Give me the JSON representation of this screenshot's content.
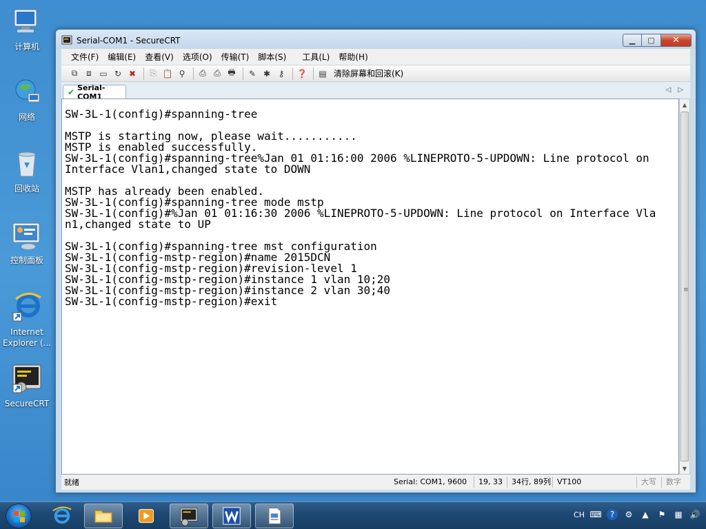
{
  "desktop": {
    "icons": [
      {
        "label": "计算机"
      },
      {
        "label": "网络"
      },
      {
        "label": "回收站"
      },
      {
        "label": "控制面板"
      },
      {
        "label": "Internet\nExplorer (..."
      },
      {
        "label": "SecureCRT"
      }
    ]
  },
  "window": {
    "title": "Serial-COM1 - SecureCRT",
    "min_label": "▁",
    "max_label": "▢",
    "close_label": "✕"
  },
  "menu": {
    "items": [
      "文件(F)",
      "编辑(E)",
      "查看(V)",
      "选项(O)",
      "传输(T)",
      "脚本(S)",
      "工具(L)",
      "帮助(H)"
    ]
  },
  "toolbar": {
    "clear_label": "清除屏幕和回滚(K)"
  },
  "tab": {
    "label": "Serial-COM1"
  },
  "terminal": {
    "lines": [
      "SW-3L-1(config)#spanning-tree",
      "",
      "MSTP is starting now, please wait...........",
      "MSTP is enabled successfully.",
      "SW-3L-1(config)#spanning-tree%Jan 01 01:16:00 2006 %LINEPROTO-5-UPDOWN: Line protocol on",
      "Interface Vlan1,changed state to DOWN",
      "",
      "MSTP has already been enabled.",
      "SW-3L-1(config)#spanning-tree mode mstp",
      "SW-3L-1(config)#%Jan 01 01:16:30 2006 %LINEPROTO-5-UPDOWN: Line protocol on Interface Vla",
      "n1,changed state to UP",
      "",
      "SW-3L-1(config)#spanning-tree mst configuration",
      "SW-3L-1(config-mstp-region)#name 2015DCN",
      "SW-3L-1(config-mstp-region)#revision-level 1",
      "SW-3L-1(config-mstp-region)#instance 1 vlan 10;20",
      "SW-3L-1(config-mstp-region)#instance 2 vlan 30;40",
      "SW-3L-1(config-mstp-region)#exit"
    ]
  },
  "status": {
    "ready": "就绪",
    "serial": "Serial: COM1, 9600",
    "cursor": "19,  33",
    "size": "34行, 89列",
    "term": "VT100",
    "caps": "大写",
    "num": "数字"
  },
  "taskbar": {
    "ime": "CH"
  },
  "colors": {
    "desktop": "#3d8dd0",
    "titlebar": "#c3d7ec",
    "close_button": "#c8462c",
    "taskbar": "#1f4a75"
  }
}
